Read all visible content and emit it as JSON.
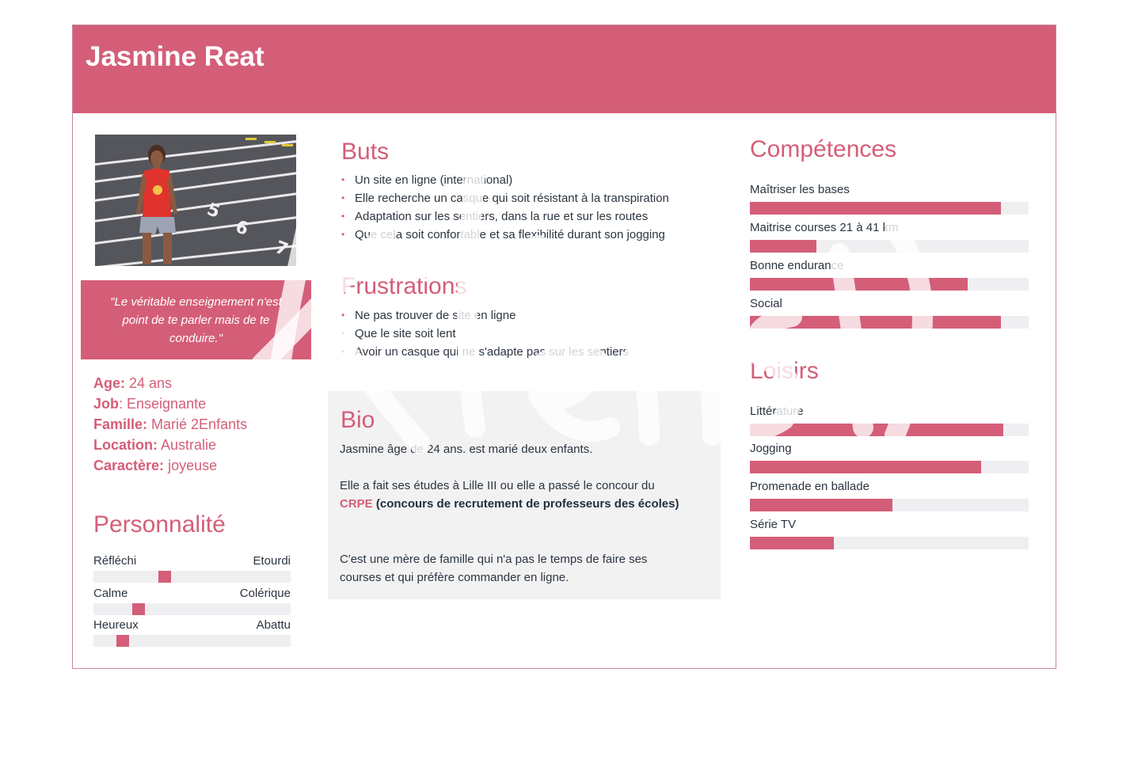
{
  "persona": {
    "name": "Jasmine Reat"
  },
  "quote": "\"Le véritable enseignement n'est point de te parler mais de te conduire.\"",
  "info": [
    {
      "key": "Age:",
      "value": " 24 ans"
    },
    {
      "key": "Job",
      "value": ": Enseignante"
    },
    {
      "key": "Famille:",
      "value": " Marié 2Enfants"
    },
    {
      "key": "Location:",
      "value": " Australie"
    },
    {
      "key": "Caractère:",
      "value": " joyeuse"
    }
  ],
  "personality": {
    "title": "Personnalité",
    "traits": [
      {
        "left": "Réfléchi",
        "right": "Etourdi",
        "level": 0.36
      },
      {
        "left": "Calme",
        "right": "Colérique",
        "level": 0.23
      },
      {
        "left": "Heureux",
        "right": "Abattu",
        "level": 0.15
      }
    ]
  },
  "goals": {
    "title": "Buts",
    "items": [
      "Un site en ligne (international)",
      "Elle recherche un casque qui soit résistant à la transpiration",
      "Adaptation sur les sentiers, dans la rue et sur les routes",
      " Que cela soit confortable et sa flexibilité durant son jogging"
    ]
  },
  "frustrations": {
    "title": "Frustrations",
    "items": [
      "Ne pas trouver de site en ligne",
      "Que le site soit lent",
      "Avoir un casque qui ne s'adapte pas sur les sentiers"
    ]
  },
  "bio": {
    "title": "Bio",
    "p1": "Jasmine âge de 24 ans. est marié deux enfants.",
    "p2": "Elle a fait ses études à Lille III ou elle a passé le concour du",
    "highlight": "CRPE",
    "p2b": " (concours de recrutement de professeurs des écoles)",
    "p3": "C'est une mère de famille qui n'a pas le temps de faire ses courses et qui préfère commander en ligne."
  },
  "skills": {
    "title": "Compétences",
    "items": [
      {
        "label": "Maîtriser les bases",
        "level": 0.9
      },
      {
        "label": "Maitrise courses 21 à 41 km",
        "level": 0.24
      },
      {
        "label": "Bonne endurance",
        "level": 0.78
      },
      {
        "label": "Social",
        "level": 0.9
      }
    ]
  },
  "hobbies": {
    "title": "Loisirs",
    "items": [
      {
        "label": "Littérature",
        "level": 0.91
      },
      {
        "label": "Jogging",
        "level": 0.83
      },
      {
        "label": "Promenade en ballade",
        "level": 0.51
      },
      {
        "label": "Série TV",
        "level": 0.3
      }
    ]
  },
  "colors": {
    "accent": "#d45e78",
    "track": "#efeff2",
    "bio_bg": "#f2f2f3",
    "text": "#2b3540"
  }
}
